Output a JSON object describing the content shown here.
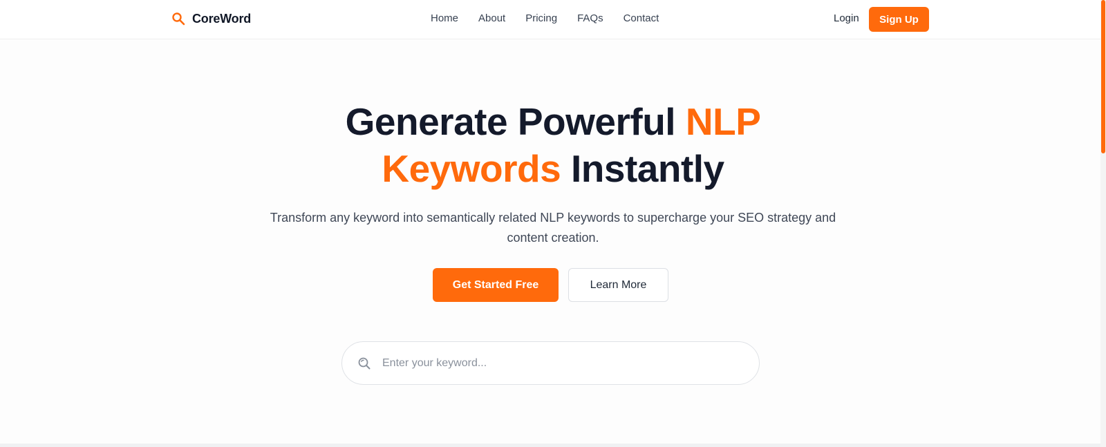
{
  "brand": {
    "name": "CoreWord",
    "icon": "search-icon"
  },
  "nav": {
    "links": [
      {
        "label": "Home"
      },
      {
        "label": "About"
      },
      {
        "label": "Pricing"
      },
      {
        "label": "FAQs"
      },
      {
        "label": "Contact"
      }
    ],
    "login_label": "Login",
    "signup_label": "Sign Up"
  },
  "hero": {
    "title_part1": "Generate Powerful ",
    "title_accent1": "NLP",
    "title_accent2": "Keywords",
    "title_part2": " Instantly",
    "subtitle": "Transform any keyword into semantically related NLP keywords to supercharge your SEO strategy and content creation.",
    "primary_cta": "Get Started Free",
    "secondary_cta": "Learn More"
  },
  "search": {
    "placeholder": "Enter your keyword...",
    "value": "",
    "icon": "search-icon"
  },
  "colors": {
    "accent": "#ff6a0c",
    "heading": "#141a2b",
    "body_text": "#3f4756"
  }
}
